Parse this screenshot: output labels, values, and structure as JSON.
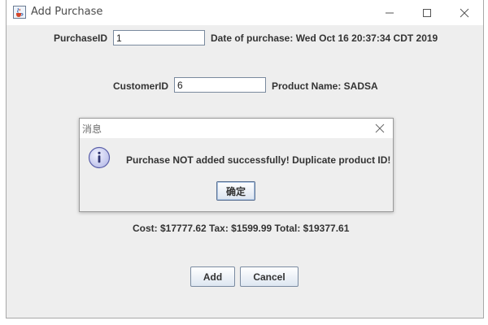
{
  "window": {
    "title": "Add Purchase",
    "icons": {
      "app": "java-cup-icon",
      "minimize": "minimize-icon",
      "maximize": "maximize-icon",
      "close": "close-icon"
    }
  },
  "form": {
    "purchase_id_label": "PurchaseID",
    "purchase_id_value": "1",
    "date_text": "Date of purchase: Wed Oct 16 20:37:34 CDT 2019",
    "customer_id_label": "CustomerID",
    "customer_id_value": "6",
    "product_name_text": "Product Name: SADSA",
    "totals_text": "Cost: $17777.62  Tax: $1599.99  Total: $19377.61",
    "add_label": "Add",
    "cancel_label": "Cancel"
  },
  "dialog": {
    "title": "消息",
    "message": "Purchase NOT added successfully! Duplicate product ID!",
    "ok_label": "确定",
    "icons": {
      "info": "info-icon",
      "close": "close-icon"
    }
  },
  "colors": {
    "button_gradient_top": "#ffffff",
    "button_gradient_bottom": "#dde6f1",
    "info_icon_fill": "#c9cdf0",
    "info_icon_stroke": "#5a5fa8"
  }
}
